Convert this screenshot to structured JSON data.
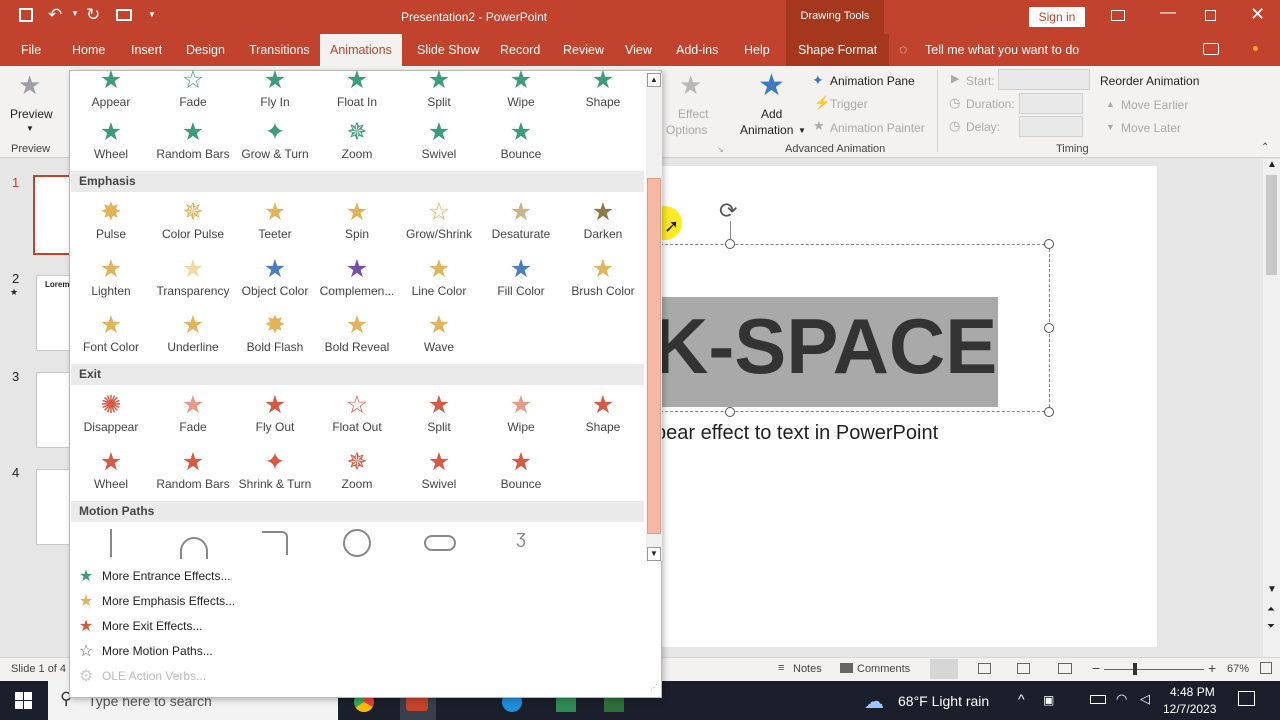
{
  "titlebar": {
    "doc_title": "Presentation2  -  PowerPoint",
    "context": "Drawing Tools",
    "sign_in": "Sign in"
  },
  "menu": {
    "tabs": [
      "File",
      "Home",
      "Insert",
      "Design",
      "Transitions",
      "Animations",
      "Slide Show",
      "Record",
      "Review",
      "View",
      "Add-ins",
      "Help",
      "Shape Format"
    ],
    "tell": "Tell me what you want to do"
  },
  "ribbon": {
    "preview": "Preview",
    "preview_group": "Preview",
    "effect_options": "Effect",
    "effect_options2": "Options",
    "add_animation": "Add",
    "add_animation2": "Animation",
    "animation_pane": "Animation Pane",
    "trigger": "Trigger",
    "animation_painter": "Animation Painter",
    "advanced_group": "Advanced Animation",
    "start": "Start:",
    "duration": "Duration:",
    "delay": "Delay:",
    "reorder": "Reorder Animation",
    "move_earlier": "Move Earlier",
    "move_later": "Move Later",
    "timing_group": "Timing"
  },
  "gallery": {
    "entrance": [
      "Appear",
      "Fade",
      "Fly In",
      "Float In",
      "Split",
      "Wipe",
      "Shape",
      "Wheel",
      "Random Bars",
      "Grow & Turn",
      "Zoom",
      "Swivel",
      "Bounce"
    ],
    "emphasis_title": "Emphasis",
    "emphasis": [
      "Pulse",
      "Color Pulse",
      "Teeter",
      "Spin",
      "Grow/Shrink",
      "Desaturate",
      "Darken",
      "Lighten",
      "Transparency",
      "Object Color",
      "Complemen...",
      "Line Color",
      "Fill Color",
      "Brush Color",
      "Font Color",
      "Underline",
      "Bold Flash",
      "Bold Reveal",
      "Wave"
    ],
    "exit_title": "Exit",
    "exit": [
      "Disappear",
      "Fade",
      "Fly Out",
      "Float Out",
      "Split",
      "Wipe",
      "Shape",
      "Wheel",
      "Random Bars",
      "Shrink & Turn",
      "Zoom",
      "Swivel",
      "Bounce"
    ],
    "motion_title": "Motion Paths",
    "more": [
      "More Entrance Effects...",
      "More Emphasis Effects...",
      "More Exit Effects...",
      "More Motion Paths...",
      "OLE Action Verbs..."
    ]
  },
  "slides": {
    "numbers": [
      "1",
      "2",
      "3",
      "4"
    ],
    "thumb2_title": "Lorem"
  },
  "slide": {
    "big_text": "K-SPACE",
    "subtitle": "pear effect to text in PowerPoint"
  },
  "status": {
    "slide": "Slide 1 of 4",
    "notes": "Notes",
    "comments": "Comments",
    "zoom": "67%"
  },
  "taskbar": {
    "search": "Type here to search",
    "weather": "68°F  Light rain",
    "time": "4:48 PM",
    "date": "12/7/2023"
  }
}
